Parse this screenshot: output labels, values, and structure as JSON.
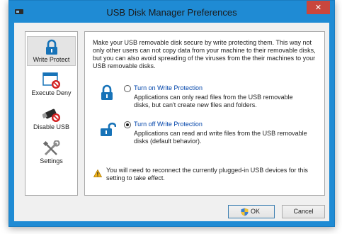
{
  "window": {
    "title": "USB Disk Manager Preferences",
    "close_glyph": "✕"
  },
  "sidebar": {
    "items": [
      {
        "label": "Write Protect",
        "icon": "padlock-icon",
        "selected": true
      },
      {
        "label": "Execute Deny",
        "icon": "window-block-icon",
        "selected": false
      },
      {
        "label": "Disable USB",
        "icon": "usb-block-icon",
        "selected": false
      },
      {
        "label": "Settings",
        "icon": "tools-icon",
        "selected": false
      }
    ]
  },
  "panel": {
    "intro": "Make your USB removable disk secure by write protecting them. This way not only other users can not copy data from your machine to their removable disks, but you can also avoid spreading of the viruses from the their machines to your USB removable disks.",
    "options": [
      {
        "label": "Turn on Write Protection",
        "description": "Applications can only read files from the USB removable disks, but can't create new files and folders.",
        "checked": false,
        "icon": "closed-lock-icon"
      },
      {
        "label": "Turn off Write Protection",
        "description": "Applications can read and write files from the USB removable disks (default behavior).",
        "checked": true,
        "icon": "open-lock-icon"
      }
    ],
    "warning": "You will need to reconnect the currently plugged-in USB devices for this setting to take effect."
  },
  "buttons": {
    "ok": "OK",
    "cancel": "Cancel"
  },
  "colors": {
    "titlebar": "#1f8bd4",
    "close": "#c9463d",
    "link": "#0044aa",
    "lock_blue": "#1773b8"
  }
}
